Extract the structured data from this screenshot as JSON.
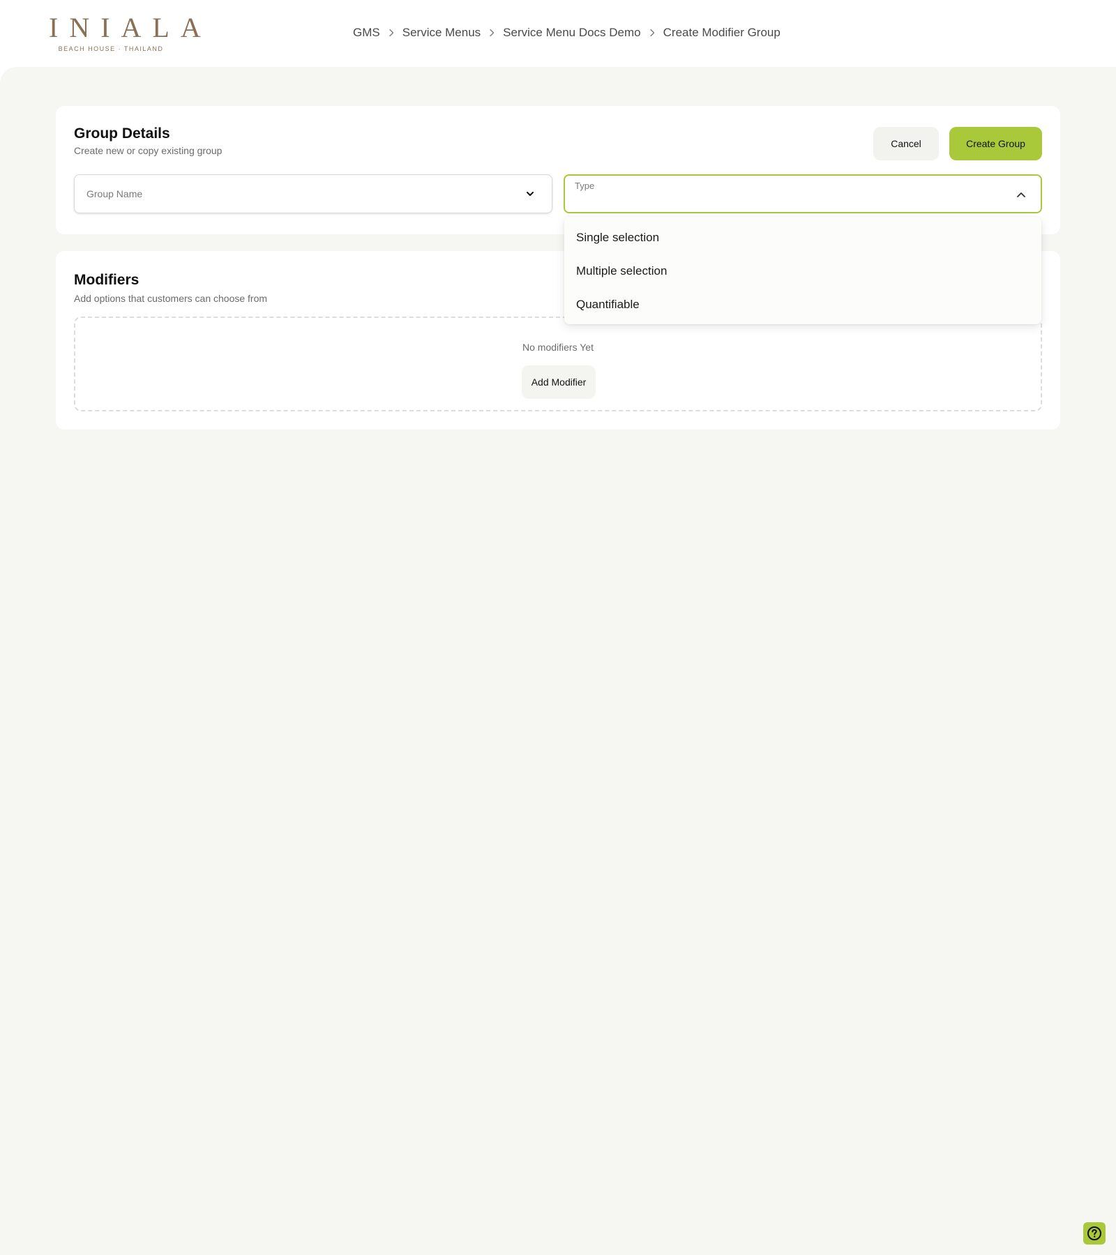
{
  "brand": {
    "name": "INIALA",
    "tagline": "BEACH HOUSE · THAILAND",
    "color": "#8a7055"
  },
  "breadcrumb": {
    "items": [
      "GMS",
      "Service Menus",
      "Service Menu Docs Demo",
      "Create Modifier Group"
    ],
    "separator_icon": "chevron-right-icon"
  },
  "group_details": {
    "title": "Group Details",
    "subtitle": "Create new or copy existing group",
    "cancel_label": "Cancel",
    "create_label": "Create Group",
    "group_name_placeholder": "Group Name",
    "type_label": "Type",
    "type_value": ""
  },
  "type_dropdown": {
    "open": true,
    "options": [
      "Single selection",
      "Multiple selection",
      "Quantifiable"
    ]
  },
  "modifiers": {
    "title": "Modifiers",
    "subtitle": "Add options that customers can choose from",
    "empty_text": "No modifiers Yet",
    "add_label": "Add Modifier"
  },
  "help": {
    "icon": "question-circle-icon"
  },
  "colors": {
    "accent": "#a9c93a",
    "background": "#f6f6f2",
    "card": "#ffffff"
  }
}
